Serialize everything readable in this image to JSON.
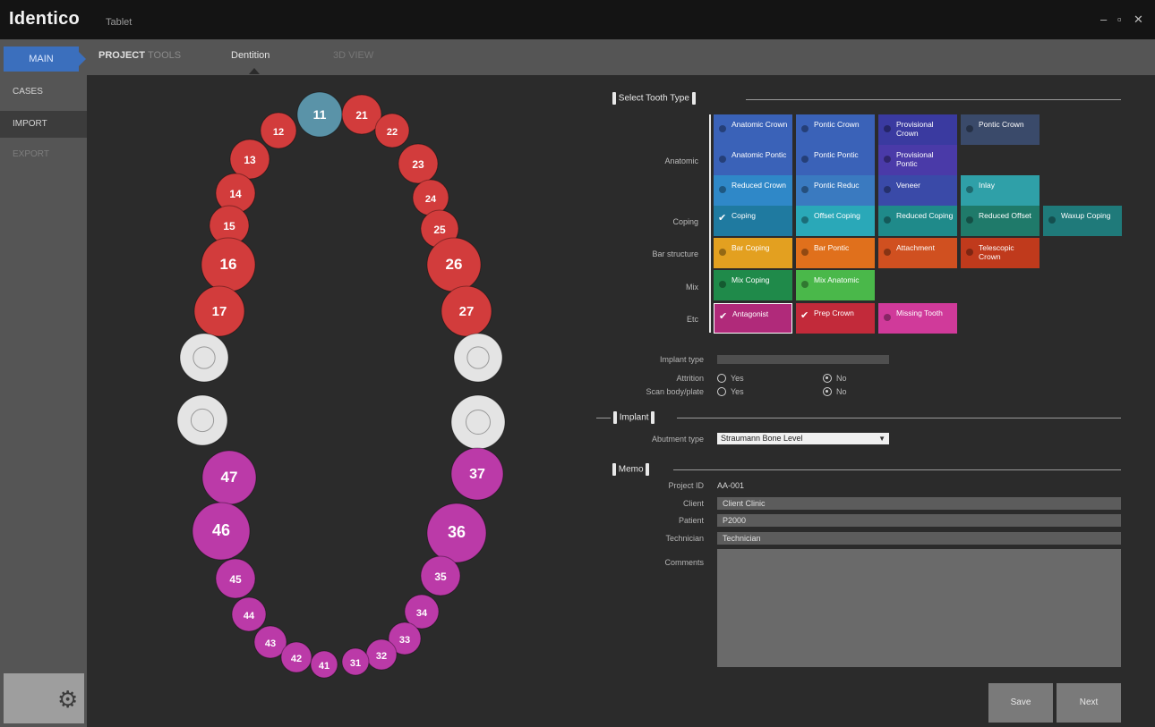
{
  "app": {
    "name": "Identico",
    "subtitle": "Tablet",
    "window_controls": [
      "–",
      "▫",
      "✕"
    ]
  },
  "tabs": {
    "main": "MAIN",
    "project_title_bold": "PROJECT",
    "project_title_dim": "TOOLS",
    "items": [
      "Dentition",
      "3D VIEW"
    ]
  },
  "sidebar": {
    "items": [
      {
        "label": "CASES",
        "state": "normal"
      },
      {
        "label": "IMPORT",
        "state": "active"
      },
      {
        "label": "EXPORT",
        "state": "dim"
      }
    ],
    "gear": "gear-icon"
  },
  "chart_data": {
    "type": "dental-chart",
    "teeth": [
      {
        "num": "11",
        "color": "#5a93a8"
      },
      {
        "num": "12",
        "color": "#d23c3c"
      },
      {
        "num": "13",
        "color": "#d23c3c"
      },
      {
        "num": "14",
        "color": "#d23c3c"
      },
      {
        "num": "15",
        "color": "#d23c3c"
      },
      {
        "num": "16",
        "color": "#d23c3c"
      },
      {
        "num": "17",
        "color": "#d23c3c"
      },
      {
        "num": "",
        "color": "#e4e4e4"
      },
      {
        "num": "",
        "color": "#e4e4e4"
      },
      {
        "num": "21",
        "color": "#d23c3c"
      },
      {
        "num": "22",
        "color": "#d23c3c"
      },
      {
        "num": "23",
        "color": "#d23c3c"
      },
      {
        "num": "24",
        "color": "#d23c3c"
      },
      {
        "num": "25",
        "color": "#d23c3c"
      },
      {
        "num": "26",
        "color": "#d23c3c"
      },
      {
        "num": "27",
        "color": "#d23c3c"
      },
      {
        "num": "",
        "color": "#e4e4e4"
      },
      {
        "num": "",
        "color": "#e4e4e4"
      },
      {
        "num": "37",
        "color": "#bb3aa8"
      },
      {
        "num": "36",
        "color": "#bb3aa8"
      },
      {
        "num": "35",
        "color": "#bb3aa8"
      },
      {
        "num": "34",
        "color": "#bb3aa8"
      },
      {
        "num": "33",
        "color": "#bb3aa8"
      },
      {
        "num": "32",
        "color": "#bb3aa8"
      },
      {
        "num": "31",
        "color": "#bb3aa8"
      },
      {
        "num": "47",
        "color": "#bb3aa8"
      },
      {
        "num": "46",
        "color": "#bb3aa8"
      },
      {
        "num": "45",
        "color": "#bb3aa8"
      },
      {
        "num": "44",
        "color": "#bb3aa8"
      },
      {
        "num": "43",
        "color": "#bb3aa8"
      },
      {
        "num": "42",
        "color": "#bb3aa8"
      },
      {
        "num": "41",
        "color": "#bb3aa8"
      }
    ]
  },
  "tooth_type": {
    "header": "Select Tooth Type",
    "rows": [
      {
        "label": "Anatomic",
        "buttons": [
          {
            "text": "Anatomic Crown",
            "color": "#3a62b8",
            "state": "dot"
          },
          {
            "text": "Pontic Crown",
            "color": "#3a62b8",
            "state": "dot"
          },
          {
            "text": "Provisional Crown",
            "color": "#3a3aa0",
            "state": "dot"
          },
          {
            "text": "Pontic Crown",
            "color": "#3a4a6a",
            "state": "dot"
          },
          {
            "text": "Anatomic Pontic",
            "color": "#3a62b8",
            "state": "dot"
          },
          {
            "text": "Pontic Pontic",
            "color": "#3a62b8",
            "state": "dot"
          },
          {
            "text": "Provisional Pontic",
            "color": "#4a3aa8",
            "state": "dot"
          },
          {
            "text": "Reduced Crown",
            "color": "#2f88c8",
            "state": "dot"
          },
          {
            "text": "Pontic Reduc",
            "color": "#3a7ac0",
            "state": "dot"
          },
          {
            "text": "Veneer",
            "color": "#3a4aa8",
            "state": "dot"
          },
          {
            "text": "Inlay",
            "color": "#2fa0a8",
            "state": "dot"
          }
        ]
      },
      {
        "label": "Coping",
        "buttons": [
          {
            "text": "Coping",
            "color": "#1f7aa0",
            "state": "check"
          },
          {
            "text": "Offset Coping",
            "color": "#2aa8b8",
            "state": "dot"
          },
          {
            "text": "Reduced Coping",
            "color": "#1f8a8a",
            "state": "dot"
          },
          {
            "text": "Reduced Offset",
            "color": "#1f7a6a",
            "state": "dot"
          },
          {
            "text": "Waxup Coping",
            "color": "#1f7a7a",
            "state": "dot"
          }
        ]
      },
      {
        "label": "Bar structure",
        "buttons": [
          {
            "text": "Bar Coping",
            "color": "#e3a020",
            "state": "dot"
          },
          {
            "text": "Bar Pontic",
            "color": "#e0701c",
            "state": "dot"
          },
          {
            "text": "Attachment",
            "color": "#d05020",
            "state": "dot"
          },
          {
            "text": "Telescopic Crown",
            "color": "#c03a1c",
            "state": "dot"
          }
        ]
      },
      {
        "label": "Mix",
        "buttons": [
          {
            "text": "Mix Coping",
            "color": "#1f8a4a",
            "state": "dot"
          },
          {
            "text": "Mix Anatomic",
            "color": "#4ab84a",
            "state": "dot"
          }
        ]
      },
      {
        "label": "Etc",
        "buttons": [
          {
            "text": "Antagonist",
            "color": "#b02a7a",
            "state": "check-selected"
          },
          {
            "text": "Prep Crown",
            "color": "#c22a3a",
            "state": "check"
          },
          {
            "text": "Missing Tooth",
            "color": "#d03a9a",
            "state": "dot"
          }
        ]
      }
    ]
  },
  "options": {
    "implant_type": "Implant type",
    "attrition": "Attrition",
    "use_scan_bodies": "Scan body/plate",
    "yes": "Yes",
    "no": "No"
  },
  "implant": {
    "header": "Implant",
    "abutment_label": "Abutment type",
    "abutment_value": "Straumann Bone Level"
  },
  "memo": {
    "header": "Memo",
    "project_label": "Project ID",
    "project_value": "AA-001",
    "client_label": "Client",
    "client_value": "Client Clinic",
    "patient_label": "Patient",
    "patient_value": "P2000",
    "technician_label": "Technician",
    "technician_value": "Technician",
    "comments_label": "Comments",
    "comments_value": ""
  },
  "actions": {
    "save": "Save",
    "next": "Next"
  }
}
